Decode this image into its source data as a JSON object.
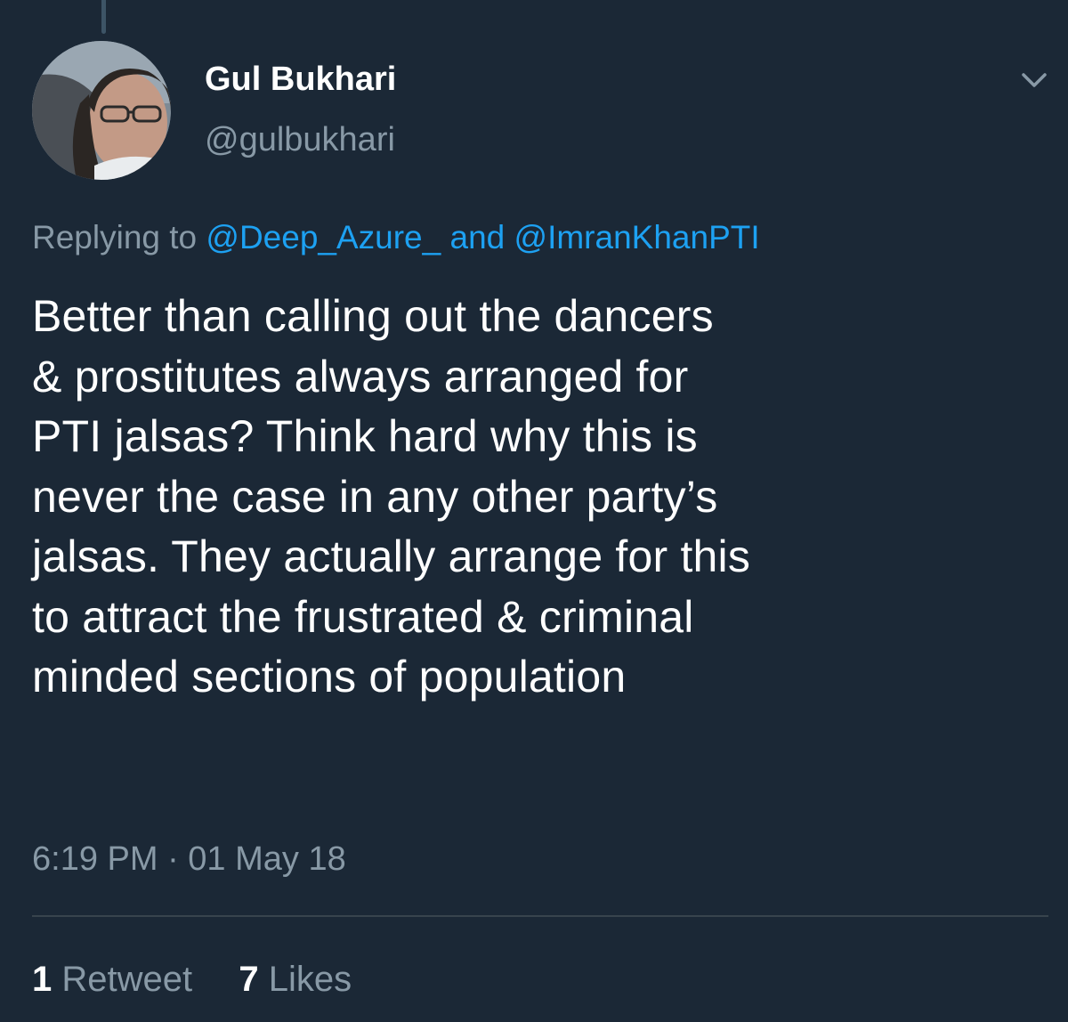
{
  "tweet": {
    "author": {
      "display_name": "Gul Bukhari",
      "handle": "@gulbukhari"
    },
    "reply": {
      "prefix": "Replying to",
      "first_user": "@Deep_Azure_",
      "joiner": "and",
      "second_user": "@ImranKhanPTI"
    },
    "body_lines": [
      "Better than calling out the dancers",
      "& prostitutes always arranged for",
      "PTI jalsas? Think hard why this is",
      "never the case in any other party’s",
      "jalsas. They actually arrange for this",
      "to attract the frustrated & criminal",
      "minded sections of population"
    ],
    "timestamp": "6:19 PM · 01 May 18",
    "stats": {
      "retweet_count": "1",
      "retweet_label": "Retweet",
      "like_count": "7",
      "like_label": "Likes"
    }
  },
  "icons": {
    "menu": "chevron-down-icon"
  },
  "colors": {
    "background": "#1b2836",
    "text": "#ffffff",
    "secondary_text": "#8899a6",
    "link": "#1da1f2",
    "divider": "#38444d"
  }
}
